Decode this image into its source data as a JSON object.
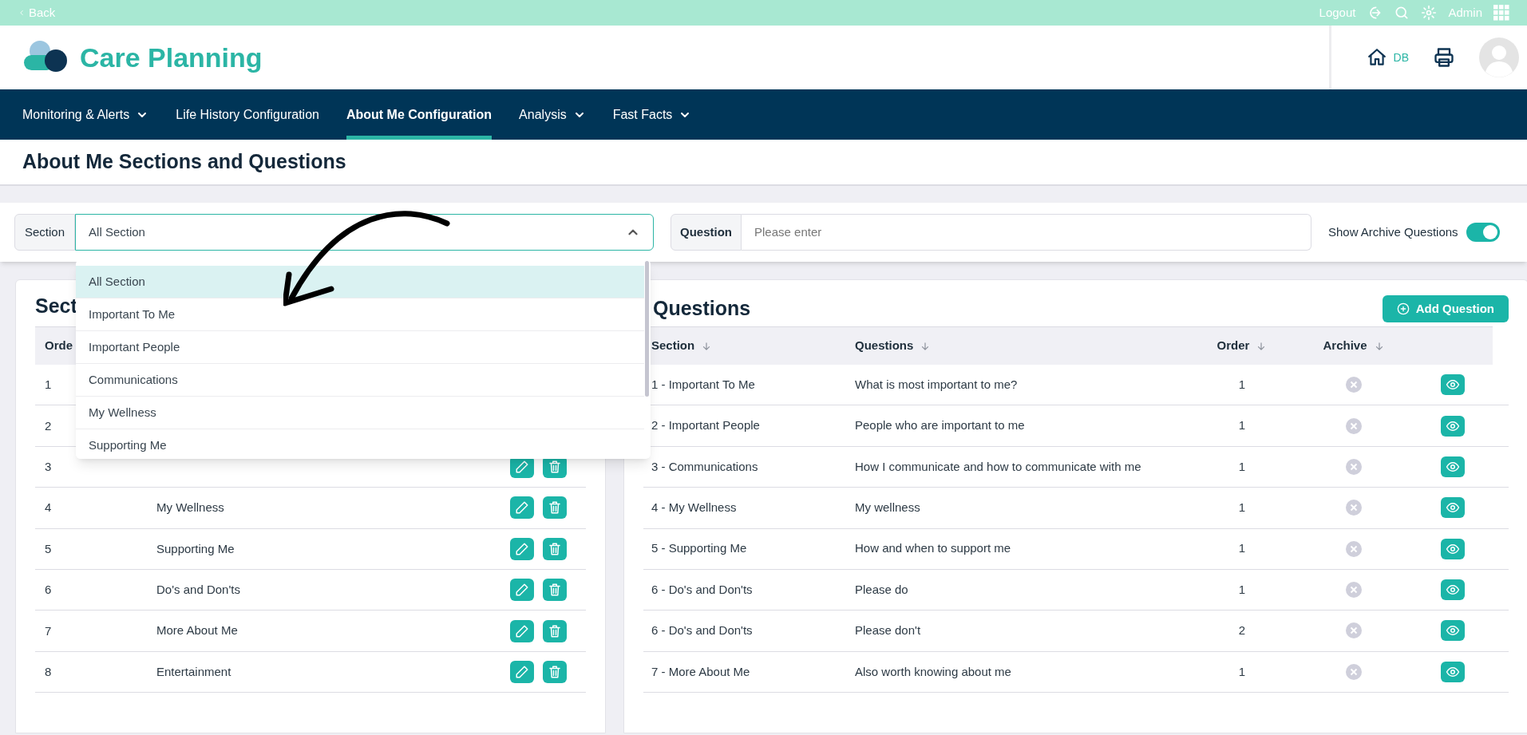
{
  "top_bar": {
    "back": "Back",
    "logout": "Logout",
    "user": "Admin"
  },
  "app": {
    "title": "Care Planning",
    "home_label": "DB"
  },
  "nav": [
    {
      "label": "Monitoring & Alerts",
      "selected": false,
      "dropdown": true
    },
    {
      "label": "Life History Configuration",
      "selected": false,
      "dropdown": false
    },
    {
      "label": "About Me Configuration",
      "selected": true,
      "dropdown": false
    },
    {
      "label": "Analysis",
      "selected": false,
      "dropdown": true
    },
    {
      "label": "Fast Facts",
      "selected": false,
      "dropdown": true
    }
  ],
  "page_title": "About Me Sections and Questions",
  "filters": {
    "section": {
      "label": "Section",
      "value": "All Section",
      "expanded": true
    },
    "question": {
      "label": "Question",
      "placeholder": "Please enter"
    },
    "archive_toggle": {
      "label": "Show Archive Questions",
      "on": true
    }
  },
  "dropdown_options": [
    {
      "label": "All Section",
      "selected": true
    },
    {
      "label": "Important To Me",
      "selected": false
    },
    {
      "label": "Important People",
      "selected": false
    },
    {
      "label": "Communications",
      "selected": false
    },
    {
      "label": "My Wellness",
      "selected": false
    },
    {
      "label": "Supporting Me",
      "selected": false
    }
  ],
  "sections_panel": {
    "title": "Sect",
    "columns": [
      "Orde"
    ],
    "rows": [
      {
        "order": "1",
        "actions": false
      },
      {
        "order": "2",
        "actions": false
      },
      {
        "order": "3",
        "actions": true
      },
      {
        "order": "4",
        "name": "My Wellness",
        "actions": true
      },
      {
        "order": "5",
        "name": "Supporting Me",
        "actions": true
      },
      {
        "order": "6",
        "name": "Do's and Don'ts",
        "actions": true
      },
      {
        "order": "7",
        "name": "More About Me",
        "actions": true
      },
      {
        "order": "8",
        "name": "Entertainment",
        "actions": true
      }
    ]
  },
  "questions_panel": {
    "title": "Questions",
    "add_button": "Add Question",
    "columns": [
      "Section",
      "Questions",
      "Order",
      "Archive"
    ],
    "rows": [
      {
        "section": "1 - Important To Me",
        "question": "What is most important to me?",
        "order": "1",
        "archived": false
      },
      {
        "section": "2 - Important People",
        "question": "People who are important to me",
        "order": "1",
        "archived": false
      },
      {
        "section": "3 - Communications",
        "question": "How I communicate and how to communicate with me",
        "order": "1",
        "archived": false
      },
      {
        "section": "4 - My Wellness",
        "question": "My wellness",
        "order": "1",
        "archived": false
      },
      {
        "section": "5 - Supporting Me",
        "question": "How and when to support me",
        "order": "1",
        "archived": false
      },
      {
        "section": "6 - Do's and Don'ts",
        "question": "Please do",
        "order": "1",
        "archived": false
      },
      {
        "section": "6 - Do's and Don'ts",
        "question": "Please don't",
        "order": "2",
        "archived": false
      },
      {
        "section": "7 - More About Me",
        "question": "Also worth knowing about me",
        "order": "1",
        "archived": false
      }
    ]
  }
}
